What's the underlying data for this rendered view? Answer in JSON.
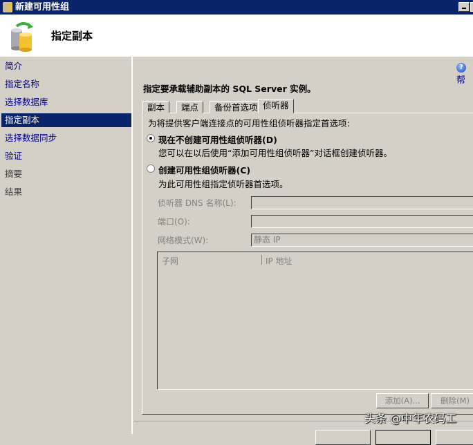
{
  "window": {
    "title": "新建可用性组"
  },
  "header": {
    "title": "指定副本"
  },
  "nav": {
    "items": [
      {
        "label": "简介",
        "state": "link"
      },
      {
        "label": "指定名称",
        "state": "link"
      },
      {
        "label": "选择数据库",
        "state": "link"
      },
      {
        "label": "指定副本",
        "state": "selected"
      },
      {
        "label": "选择数据同步",
        "state": "link"
      },
      {
        "label": "验证",
        "state": "link"
      },
      {
        "label": "摘要",
        "state": "disabled"
      },
      {
        "label": "结果",
        "state": "disabled"
      }
    ]
  },
  "help": {
    "label": "帮"
  },
  "main": {
    "heading": "指定要承载辅助副本的 SQL Server 实例。",
    "tabs": [
      "副本",
      "端点",
      "备份首选项",
      "侦听器"
    ],
    "active_tab": "侦听器",
    "intro": "为将提供客户端连接点的可用性组侦听器指定首选项:",
    "option1": {
      "label": "现在不创建可用性组侦听器(D)",
      "desc": "您可以在以后使用“添加可用性组侦听器”对话框创建侦听器。",
      "checked": true
    },
    "option2": {
      "label": "创建可用性组侦听器(C)",
      "desc": "为此可用性组指定侦听器首选项。",
      "checked": false
    },
    "fields": {
      "dns_label": "侦听器 DNS 名称(L):",
      "dns_value": "",
      "port_label": "端口(O):",
      "port_value": "",
      "mode_label": "网络模式(W):",
      "mode_value": "静态 IP"
    },
    "table": {
      "columns": [
        "子网",
        "IP 地址"
      ],
      "rows": []
    },
    "buttons": {
      "add": "添加(A)...",
      "remove": "删除(M)"
    }
  },
  "watermark": "头条 @中年农码工"
}
